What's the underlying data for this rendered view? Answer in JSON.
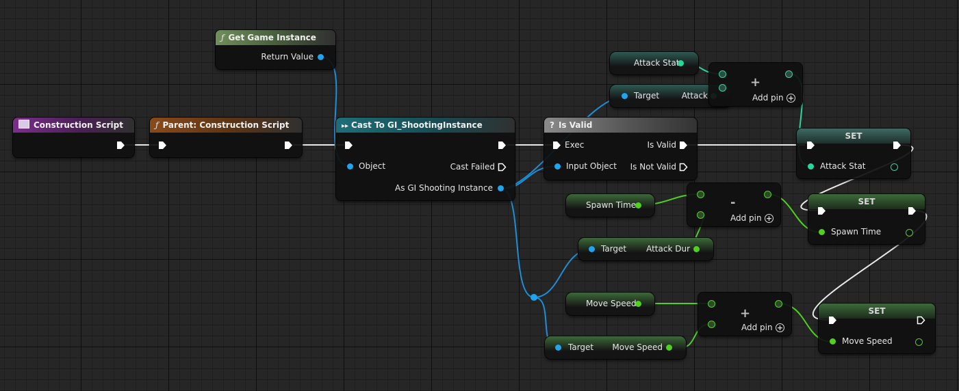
{
  "colors": {
    "exec": "#ffffff",
    "object_pin": "#1fa4f0",
    "int_pin": "#2ad79b",
    "float_pin": "#4fd11f"
  },
  "nodes": {
    "construction_script": {
      "title": "Construction Script",
      "icon": "event-icon"
    },
    "parent_construction": {
      "title": "Parent: Construction Script",
      "icon": "function-icon"
    },
    "get_game_instance": {
      "title": "Get Game Instance",
      "icon": "function-icon",
      "return_value": "Return Value"
    },
    "cast_to": {
      "title": "Cast To GI_ShootingInstance",
      "icon": "cast-icon",
      "object": "Object",
      "cast_failed": "Cast Failed",
      "as_instance": "As GI Shooting Instance"
    },
    "is_valid": {
      "title": "Is Valid",
      "icon": "question-icon",
      "exec": "Exec",
      "is_valid": "Is Valid",
      "input_object": "Input Object",
      "is_not_valid": "Is Not Valid"
    },
    "attack_stat_var": {
      "label": "Attack Stat"
    },
    "target_attack": {
      "target": "Target",
      "out": "Attack"
    },
    "add_attack": {
      "op": "+",
      "add_pin": "Add pin"
    },
    "set_attack": {
      "title": "SET",
      "field": "Attack Stat"
    },
    "spawn_time_var": {
      "label": "Spawn Time"
    },
    "subtract_spawn": {
      "op": "-",
      "add_pin": "Add pin"
    },
    "target_attack_dur": {
      "target": "Target",
      "out": "Attack Dur"
    },
    "set_spawn": {
      "title": "SET",
      "field": "Spawn Time"
    },
    "move_speed_var": {
      "label": "Move Speed"
    },
    "add_move": {
      "op": "+",
      "add_pin": "Add pin"
    },
    "target_move_speed": {
      "target": "Target",
      "out": "Move Speed"
    },
    "set_move": {
      "title": "SET",
      "field": "Move Speed"
    }
  }
}
